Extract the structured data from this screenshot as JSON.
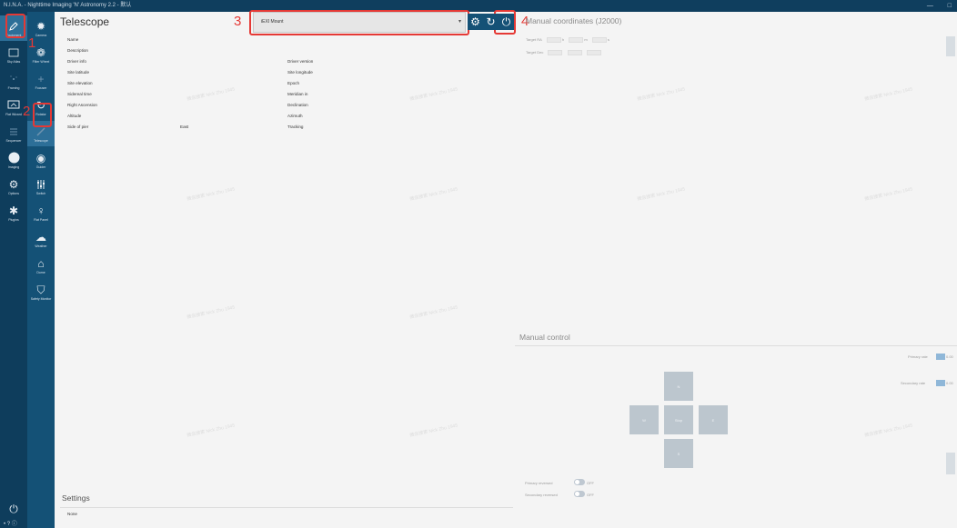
{
  "window": {
    "title": "N.I.N.A. - Nighttime Imaging 'N' Astronomy 2.2 - 默认",
    "min": "—",
    "max": "□"
  },
  "nav_primary": [
    {
      "label": "Equipment",
      "icon": "pencil-icon"
    },
    {
      "label": "Sky Atlas",
      "icon": "sky-atlas-icon"
    },
    {
      "label": "Framing",
      "icon": "framing-icon"
    },
    {
      "label": "Flat Wizard",
      "icon": "flat-wizard-icon"
    },
    {
      "label": "Sequencer",
      "icon": "sequencer-icon"
    },
    {
      "label": "Imaging",
      "icon": "circle-icon"
    },
    {
      "label": "Options",
      "icon": "gears-icon"
    },
    {
      "label": "Plugins",
      "icon": "puzzle-icon"
    }
  ],
  "nav_secondary": [
    {
      "label": "Camera",
      "icon": "camera-icon"
    },
    {
      "label": "Filter Wheel",
      "icon": "filter-wheel-icon"
    },
    {
      "label": "Focuser",
      "icon": "focuser-icon"
    },
    {
      "label": "Rotator",
      "icon": "rotator-icon"
    },
    {
      "label": "Telescope",
      "icon": "telescope-icon"
    },
    {
      "label": "Guider",
      "icon": "guider-icon"
    },
    {
      "label": "Switch",
      "icon": "switch-icon"
    },
    {
      "label": "Flat Panel",
      "icon": "flat-panel-icon"
    },
    {
      "label": "Weather",
      "icon": "weather-icon"
    },
    {
      "label": "Dome",
      "icon": "dome-icon"
    },
    {
      "label": "Safety Monitor",
      "icon": "safety-monitor-icon"
    }
  ],
  "annotations": [
    "1",
    "2",
    "3",
    "4"
  ],
  "telescope": {
    "title": "Telescope",
    "selected_mount": "iEXI Mount",
    "properties": [
      "Name",
      "Description",
      "Driver info",
      "Site latitude",
      "Site elevation",
      "Sidereal time",
      "Right Ascension",
      "Altitude",
      "Side of pier"
    ],
    "side_of_pier_value": "East",
    "right_labels": [
      "Driver version",
      "Site longitude",
      "Epoch",
      "Meridian in",
      "Declination",
      "Azimuth",
      "Tracking"
    ]
  },
  "manual_coordinates": {
    "title": "Manual coordinates (J2000)",
    "target_ra": "Target RA",
    "target_dec": "Target Dec",
    "units": [
      "h",
      "m",
      "s"
    ]
  },
  "manual_control": {
    "title": "Manual control",
    "north": "N",
    "south": "S",
    "west": "W",
    "east": "E",
    "stop": "Stop",
    "primary_rate": "Primary rate",
    "secondary_rate": "Secondary rate",
    "rate_value": "0.00",
    "primary_reversed": "Primary reversed",
    "secondary_reversed": "Secondary reversed",
    "toggle_state": "OFF"
  },
  "settings": {
    "title": "Settings",
    "value": "None"
  },
  "watermark": "微信搜索 Nick Zhu 1945"
}
